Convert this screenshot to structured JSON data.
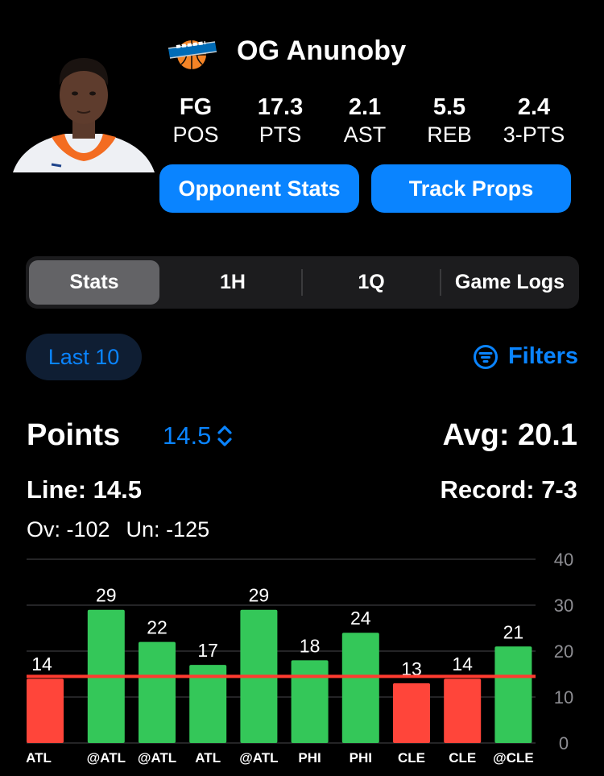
{
  "player": {
    "name": "OG Anunoby",
    "team_logo": "knicks-logo",
    "stats": [
      {
        "value": "FG",
        "label": "POS"
      },
      {
        "value": "17.3",
        "label": "PTS"
      },
      {
        "value": "2.1",
        "label": "AST"
      },
      {
        "value": "5.5",
        "label": "REB"
      },
      {
        "value": "2.4",
        "label": "3-PTS"
      }
    ]
  },
  "buttons": {
    "opponent_stats": "Opponent Stats",
    "track_props": "Track Props"
  },
  "tabs": [
    {
      "label": "Stats",
      "active": true
    },
    {
      "label": "1H",
      "active": false
    },
    {
      "label": "1Q",
      "active": false
    },
    {
      "label": "Game Logs",
      "active": false
    }
  ],
  "filters": {
    "range": "Last 10",
    "filters_label": "Filters"
  },
  "prop": {
    "stat": "Points",
    "line_value": "14.5",
    "avg": "Avg: 20.1",
    "line": "Line: 14.5",
    "record": "Record: 7-3",
    "over": "Ov: -102",
    "under": "Un: -125"
  },
  "colors": {
    "accent": "#0a84ff",
    "over": "#34c759",
    "under": "#ff453a",
    "line": "#ff3b30"
  },
  "chart_data": {
    "type": "bar",
    "categories": [
      "ATL",
      "@ATL",
      "@ATL",
      "ATL",
      "@ATL",
      "PHI",
      "PHI",
      "CLE",
      "CLE",
      "@CLE"
    ],
    "values": [
      14,
      29,
      22,
      17,
      29,
      18,
      24,
      13,
      14,
      21
    ],
    "line": 14.5,
    "ylim": [
      0,
      40
    ],
    "yticks": [
      "0",
      "10",
      "20",
      "30",
      "40"
    ],
    "grid": true,
    "y_axis_side": "right"
  }
}
